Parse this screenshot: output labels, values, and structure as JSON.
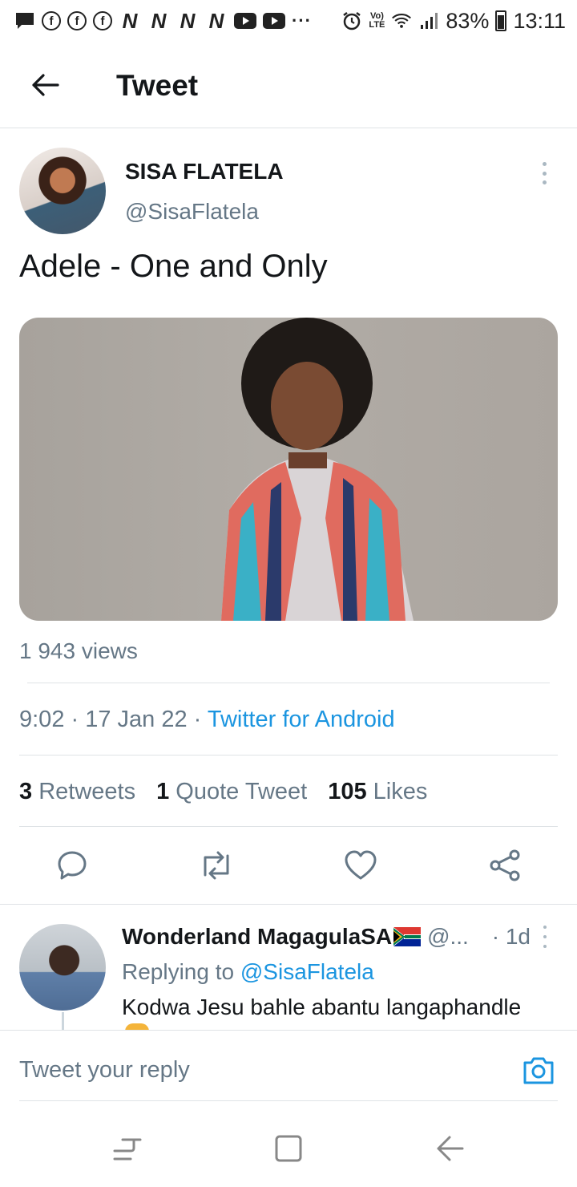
{
  "status_bar": {
    "notification_icons": [
      "message-icon",
      "facebook-icon",
      "facebook-icon",
      "facebook-icon",
      "netflix-n-icon",
      "netflix-n-icon",
      "netflix-n-icon",
      "netflix-n-icon",
      "youtube-icon",
      "youtube-icon"
    ],
    "facebook_letter": "f",
    "netflix_letter": "N",
    "more_dots": "···",
    "volte_line1": "Vo)",
    "volte_line2": "LTE",
    "battery": "83%",
    "time": "13:11"
  },
  "header": {
    "title": "Tweet",
    "back_icon": "arrow-left-icon"
  },
  "tweet": {
    "author_name": "SISA FLATELA",
    "author_handle": "@SisaFlatela",
    "text": "Adele - One and Only",
    "views": "1 943 views",
    "time": "9:02",
    "date": "17 Jan 22",
    "separator": " · ",
    "source": "Twitter for Android",
    "retweets_count": "3",
    "retweets_label": "Retweets",
    "quotes_count": "1",
    "quotes_label": "Quote Tweet",
    "likes_count": "105",
    "likes_label": "Likes"
  },
  "actions": [
    "reply-icon",
    "retweet-icon",
    "like-icon",
    "share-icon"
  ],
  "reply": {
    "author_name": "Wonderland MagagulaSA",
    "flag": "south-africa-flag-icon",
    "author_handle": "@...",
    "time": "· 1d",
    "replying_prefix": "Replying to",
    "replying_to": "@SisaFlatela",
    "text": "Kodwa Jesu bahle abantu langaphandle"
  },
  "compose": {
    "placeholder": "Tweet your reply",
    "camera_icon": "camera-icon"
  },
  "nav": [
    "recents-icon",
    "home-icon",
    "back-icon"
  ],
  "colors": {
    "accent": "#1b95e0",
    "text_primary": "#14171a",
    "text_secondary": "#657786",
    "divider": "#dfe3e6"
  }
}
